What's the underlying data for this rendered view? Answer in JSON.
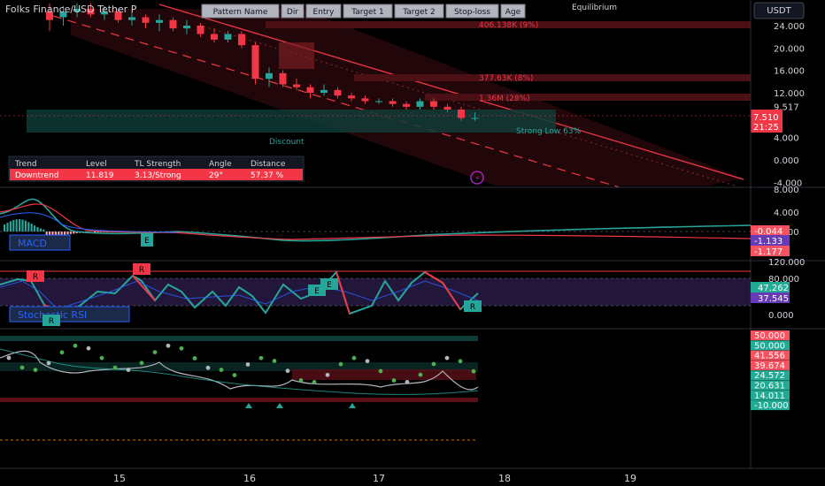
{
  "header": {
    "symbol_title": "Folks Finance/USD Tether P",
    "currency": "USDT",
    "equilibrium_label": "Equilibrium",
    "pattern_columns": [
      "Pattern Name",
      "Dir",
      "Entry",
      "Target 1",
      "Target 2",
      "Stop-loss",
      "Age"
    ]
  },
  "main_chart": {
    "level_labels": [
      "406.138K (9%)",
      "377.63K (8%)",
      "1.36M (28%)"
    ],
    "zone_labels": {
      "discount": "Discount",
      "strong_low": "Strong Low 63%"
    },
    "price_axis": [
      "24.000",
      "20.000",
      "16.000",
      "12.000",
      "9.517",
      "4.000",
      "0.000",
      "-4.000"
    ],
    "price_badge": {
      "price": "7.510",
      "countdown": "21:25"
    },
    "candles": [
      {
        "x": "14.7",
        "o": 26.5,
        "h": 28.0,
        "l": 23.0,
        "c": 25.0
      },
      {
        "x": "14.8",
        "o": 25.5,
        "h": 27.5,
        "l": 24.0,
        "c": 26.5
      },
      {
        "x": "14.9",
        "o": 26.5,
        "h": 28.0,
        "l": 25.5,
        "c": 27.0
      },
      {
        "x": "15.0",
        "o": 27.0,
        "h": 28.0,
        "l": 25.5,
        "c": 26.0
      },
      {
        "x": "15.1",
        "o": 26.0,
        "h": 27.5,
        "l": 25.0,
        "c": 26.5
      },
      {
        "x": "15.2",
        "o": 26.5,
        "h": 27.0,
        "l": 24.5,
        "c": 25.0
      },
      {
        "x": "15.3",
        "o": 25.0,
        "h": 26.5,
        "l": 24.0,
        "c": 25.5
      },
      {
        "x": "15.4",
        "o": 25.5,
        "h": 26.0,
        "l": 23.5,
        "c": 24.5
      },
      {
        "x": "15.5",
        "o": 24.5,
        "h": 26.0,
        "l": 23.0,
        "c": 25.0
      },
      {
        "x": "15.6",
        "o": 25.0,
        "h": 25.5,
        "l": 23.0,
        "c": 23.5
      },
      {
        "x": "15.7",
        "o": 23.5,
        "h": 25.0,
        "l": 22.5,
        "c": 24.0
      },
      {
        "x": "15.8",
        "o": 24.0,
        "h": 24.5,
        "l": 22.0,
        "c": 22.5
      },
      {
        "x": "15.9",
        "o": 22.5,
        "h": 23.5,
        "l": 21.0,
        "c": 21.5
      },
      {
        "x": "16.0",
        "o": 21.5,
        "h": 23.0,
        "l": 21.0,
        "c": 22.5
      },
      {
        "x": "16.1",
        "o": 22.5,
        "h": 23.0,
        "l": 20.0,
        "c": 20.5
      },
      {
        "x": "16.2",
        "o": 20.5,
        "h": 21.0,
        "l": 13.5,
        "c": 14.5
      },
      {
        "x": "16.3",
        "o": 14.5,
        "h": 16.5,
        "l": 13.0,
        "c": 15.5
      },
      {
        "x": "16.4",
        "o": 15.5,
        "h": 16.0,
        "l": 13.0,
        "c": 13.5
      },
      {
        "x": "16.5",
        "o": 13.5,
        "h": 14.5,
        "l": 12.5,
        "c": 13.0
      },
      {
        "x": "16.6",
        "o": 13.0,
        "h": 13.5,
        "l": 11.0,
        "c": 12.0
      },
      {
        "x": "16.7",
        "o": 12.0,
        "h": 13.5,
        "l": 11.5,
        "c": 12.5
      },
      {
        "x": "16.8",
        "o": 12.5,
        "h": 13.0,
        "l": 11.0,
        "c": 11.5
      },
      {
        "x": "16.9",
        "o": 11.5,
        "h": 12.0,
        "l": 10.5,
        "c": 11.0
      },
      {
        "x": "17.0",
        "o": 11.0,
        "h": 11.5,
        "l": 10.0,
        "c": 10.5
      },
      {
        "x": "17.1",
        "o": 10.5,
        "h": 11.0,
        "l": 10.0,
        "c": 10.5
      },
      {
        "x": "17.2",
        "o": 10.5,
        "h": 11.0,
        "l": 9.5,
        "c": 10.0
      },
      {
        "x": "17.3",
        "o": 10.0,
        "h": 10.5,
        "l": 9.0,
        "c": 9.5
      },
      {
        "x": "17.4",
        "o": 9.5,
        "h": 11.0,
        "l": 9.0,
        "c": 10.5
      },
      {
        "x": "17.5",
        "o": 10.5,
        "h": 11.0,
        "l": 9.0,
        "c": 9.5
      },
      {
        "x": "17.6",
        "o": 9.5,
        "h": 10.0,
        "l": 8.5,
        "c": 9.0
      },
      {
        "x": "17.7",
        "o": 9.0,
        "h": 9.5,
        "l": 7.0,
        "c": 7.5
      },
      {
        "x": "17.8",
        "o": 7.5,
        "h": 8.5,
        "l": 7.0,
        "c": 7.5
      }
    ]
  },
  "trend_table": {
    "headers": [
      "Trend",
      "Level",
      "TL Strength",
      "Angle",
      "Distance"
    ],
    "row": [
      "Downtrend",
      "11.819",
      "3.13/Strong",
      "29°",
      "57.37 %"
    ]
  },
  "macd": {
    "label": "MACD",
    "axis": [
      "8.000",
      "4.000",
      "0.000"
    ],
    "badges": [
      "-0.044",
      "-1.133",
      "-1.177"
    ],
    "markers": [
      "E"
    ]
  },
  "stoch_rsi": {
    "label": "Stochastic RSI",
    "axis": [
      "120.000",
      "80.000",
      "0.000"
    ],
    "badges": [
      "47.262",
      "37.545"
    ],
    "markers": [
      "R",
      "R",
      "E",
      "E",
      "R",
      "R"
    ]
  },
  "oscillator": {
    "badges": [
      "50.000",
      "50.000",
      "41.556",
      "39.674",
      "24.572",
      "20.631",
      "14.011",
      "-10.000"
    ]
  },
  "time_axis": [
    "15",
    "16",
    "17",
    "18",
    "19"
  ],
  "colors": {
    "bull": "#26a69a",
    "bear": "#f23645",
    "macd": "#2962ff",
    "signal": "#ff6d00",
    "k_line": "#7e57c2",
    "badge_green": "#22ab94",
    "badge_red": "#f7525f",
    "badge_purple": "#673ab7"
  }
}
